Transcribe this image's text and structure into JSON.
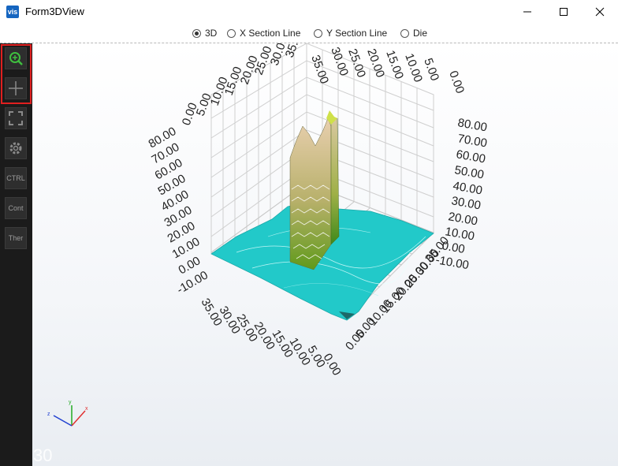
{
  "window": {
    "app_icon_text": "vis",
    "title": "Form3DView"
  },
  "view_modes": [
    {
      "label": "3D",
      "checked": true
    },
    {
      "label": "X Section Line",
      "checked": false
    },
    {
      "label": "Y Section Line",
      "checked": false
    },
    {
      "label": "Die",
      "checked": false
    }
  ],
  "sidebar": {
    "items": [
      {
        "name": "zoom-icon",
        "label": ""
      },
      {
        "name": "pan-icon",
        "label": ""
      },
      {
        "name": "fit-view-icon",
        "label": ""
      },
      {
        "name": "gear-icon",
        "label": ""
      },
      {
        "name": "ctrl-button",
        "label": "CTRL"
      },
      {
        "name": "cont-button",
        "label": "Cont"
      },
      {
        "name": "ther-button",
        "label": "Ther"
      }
    ]
  },
  "plot": {
    "x_axis_ticks": [
      "0.00",
      "5.00",
      "10.00",
      "15.00",
      "20.00",
      "25.00",
      "30.00",
      "35.00"
    ],
    "y_axis_ticks": [
      "0.00",
      "5.00",
      "10.00",
      "15.00",
      "20.00",
      "25.00",
      "30.00",
      "35.00"
    ],
    "z_axis_ticks_left": [
      "-10.00",
      "0.00",
      "10.00",
      "20.00",
      "30.00",
      "40.00",
      "50.00",
      "60.00",
      "70.00",
      "80.00"
    ],
    "z_axis_ticks_right": [
      "80.00",
      "70.00",
      "60.00",
      "50.00",
      "40.00",
      "30.00",
      "20.00",
      "10.00",
      "0.00",
      "-10.00"
    ],
    "axis_gizmo": {
      "x": "x",
      "y": "y",
      "z": "z"
    },
    "fps": "30"
  },
  "colors": {
    "surface": "#22c9c9",
    "peak_top": "#e8cfae",
    "peak_mid": "#8fb23a",
    "highlight": "#e02020"
  }
}
